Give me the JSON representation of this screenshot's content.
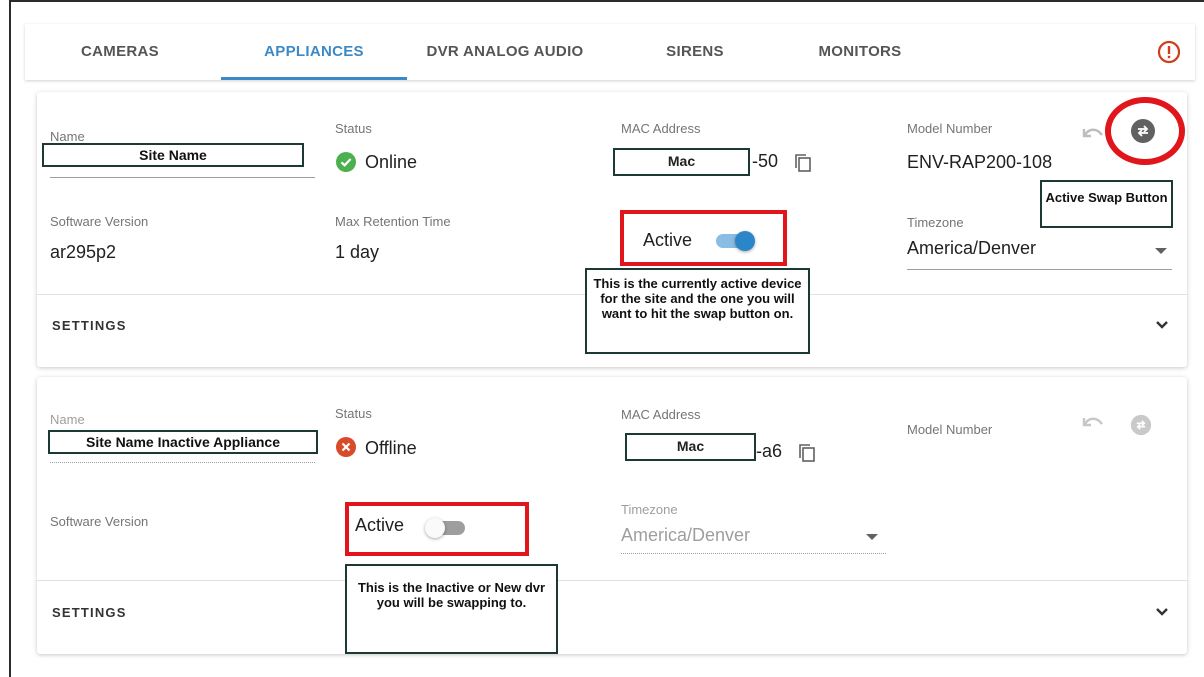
{
  "tabs": [
    {
      "label": "CAMERAS"
    },
    {
      "label": "APPLIANCES"
    },
    {
      "label": "DVR ANALOG AUDIO"
    },
    {
      "label": "SIRENS"
    },
    {
      "label": "MONITORS"
    }
  ],
  "active_tab": "APPLIANCES",
  "colors": {
    "accent": "#3b89c7",
    "online": "#4caf50",
    "offline": "#d84b2a",
    "annotation_red": "#e0161c",
    "annotation_border": "#1b3a35"
  },
  "appliance1": {
    "name_label": "Name",
    "name_value": "Site Name",
    "status_label": "Status",
    "status_value": "Online",
    "mac_label": "MAC Address",
    "mac_value": "Mac",
    "mac_suffix": "-50",
    "model_label": "Model Number",
    "model_value": "ENV-RAP200-108",
    "software_label": "Software Version",
    "software_value": "ar295p2",
    "retention_label": "Max Retention Time",
    "retention_value": "1 day",
    "active_label": "Active",
    "active_on": true,
    "timezone_label": "Timezone",
    "timezone_value": "America/Denver",
    "settings_label": "SETTINGS"
  },
  "appliance2": {
    "name_label": "Name",
    "name_value": "Site Name Inactive Appliance",
    "status_label": "Status",
    "status_value": "Offline",
    "mac_label": "MAC Address",
    "mac_value": "Mac",
    "mac_suffix": "-a6",
    "model_label": "Model Number",
    "software_label": "Software Version",
    "active_label": "Active",
    "active_on": false,
    "timezone_label": "Timezone",
    "timezone_value": "America/Denver",
    "settings_label": "SETTINGS"
  },
  "annotations": {
    "swap_button": "Active Swap Button",
    "active_device_note": "This is the currently active device for the site and the one you will want to hit the swap button on.",
    "inactive_device_note": "This is the Inactive or New dvr you will be swapping to."
  },
  "icons": [
    "alert-circle-icon",
    "check-circle-icon",
    "x-circle-icon",
    "copy-icon",
    "undo-icon",
    "swap-icon",
    "chevron-down-icon"
  ]
}
